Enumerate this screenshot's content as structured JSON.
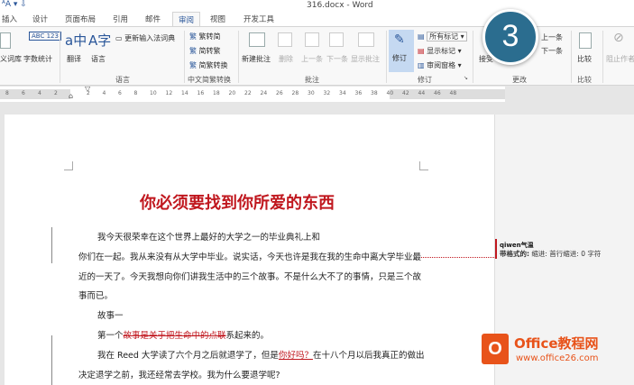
{
  "titlebar": {
    "title": "316.docx - Word"
  },
  "tabs": [
    "插入",
    "设计",
    "页面布局",
    "引用",
    "邮件",
    "审阅",
    "视图",
    "开发工具"
  ],
  "ribbon": {
    "proofing": {
      "thesaurus": "义词库",
      "word_count": "字数统计",
      "word_count_icon": "ABC 123"
    },
    "language": {
      "translate": "翻译",
      "language": "语言",
      "update_ime": "更新输入法词典",
      "group": "语言"
    },
    "chinese": {
      "t2s": "繁转简",
      "s2t": "简转繁",
      "convert": "简繁转换",
      "group": "中文简繁转换"
    },
    "comments": {
      "new": "新建批注",
      "delete": "删除",
      "prev": "上一条",
      "next": "下一条",
      "show": "显示批注",
      "group": "批注"
    },
    "tracking": {
      "track": "修订",
      "markup_select": "所有标记",
      "show_markup": "显示标记",
      "review_pane": "审阅窗格",
      "group": "修订"
    },
    "changes": {
      "accept": "接受",
      "prev": "上一条",
      "next": "下一条",
      "group": "更改"
    },
    "compare": {
      "compare": "比较",
      "group": "比较"
    },
    "protect": {
      "block": "阻止作者"
    }
  },
  "ruler": {
    "left": [
      "8",
      "6",
      "4",
      "2"
    ],
    "right": [
      "2",
      "4",
      "6",
      "8",
      "10",
      "12",
      "14",
      "16",
      "18",
      "20",
      "22",
      "24",
      "26",
      "28",
      "30",
      "32",
      "34",
      "36",
      "38",
      "40",
      "42",
      "44",
      "46",
      "48"
    ]
  },
  "document": {
    "title": "你必须要找到你所爱的东西",
    "p1": "我今天很荣幸在这个世界上最好的大学之一的毕业典礼上和",
    "p2a": "你们在一起。我从来没有从大学中毕业。说实话，今天也许是我在我的生命中离大学毕业最",
    "p2b": "近的一天了。今天我想向你们讲我生活中的三个故事。不是什么大不了的事情，只是三个故",
    "p2c": "事而已。",
    "p3": "故事一",
    "p4a": "第一个",
    "p4del": "故事是关于把生命中的点联",
    "p4b": "系起来的。",
    "p5a": "我在 Reed 大学读了六个月之后就退学了，但是",
    "p5ins": "你好吗？",
    "p5b": "在十八个月以后我真正的做出",
    "p6": "决定退学之前，我还经常去学校。我为什么要退学呢?"
  },
  "markup_balloon": {
    "author": "qiwen气温",
    "label": "带格式的:",
    "detail": "缩进: 首行缩进:  0 字符"
  },
  "badge": "3",
  "watermark": {
    "name": "Office教程网",
    "url": "www.office26.com"
  },
  "colors": {
    "accent": "#2b579a",
    "revision": "#c0171e",
    "badge": "#2b6d8f",
    "logo": "#e8531a"
  }
}
